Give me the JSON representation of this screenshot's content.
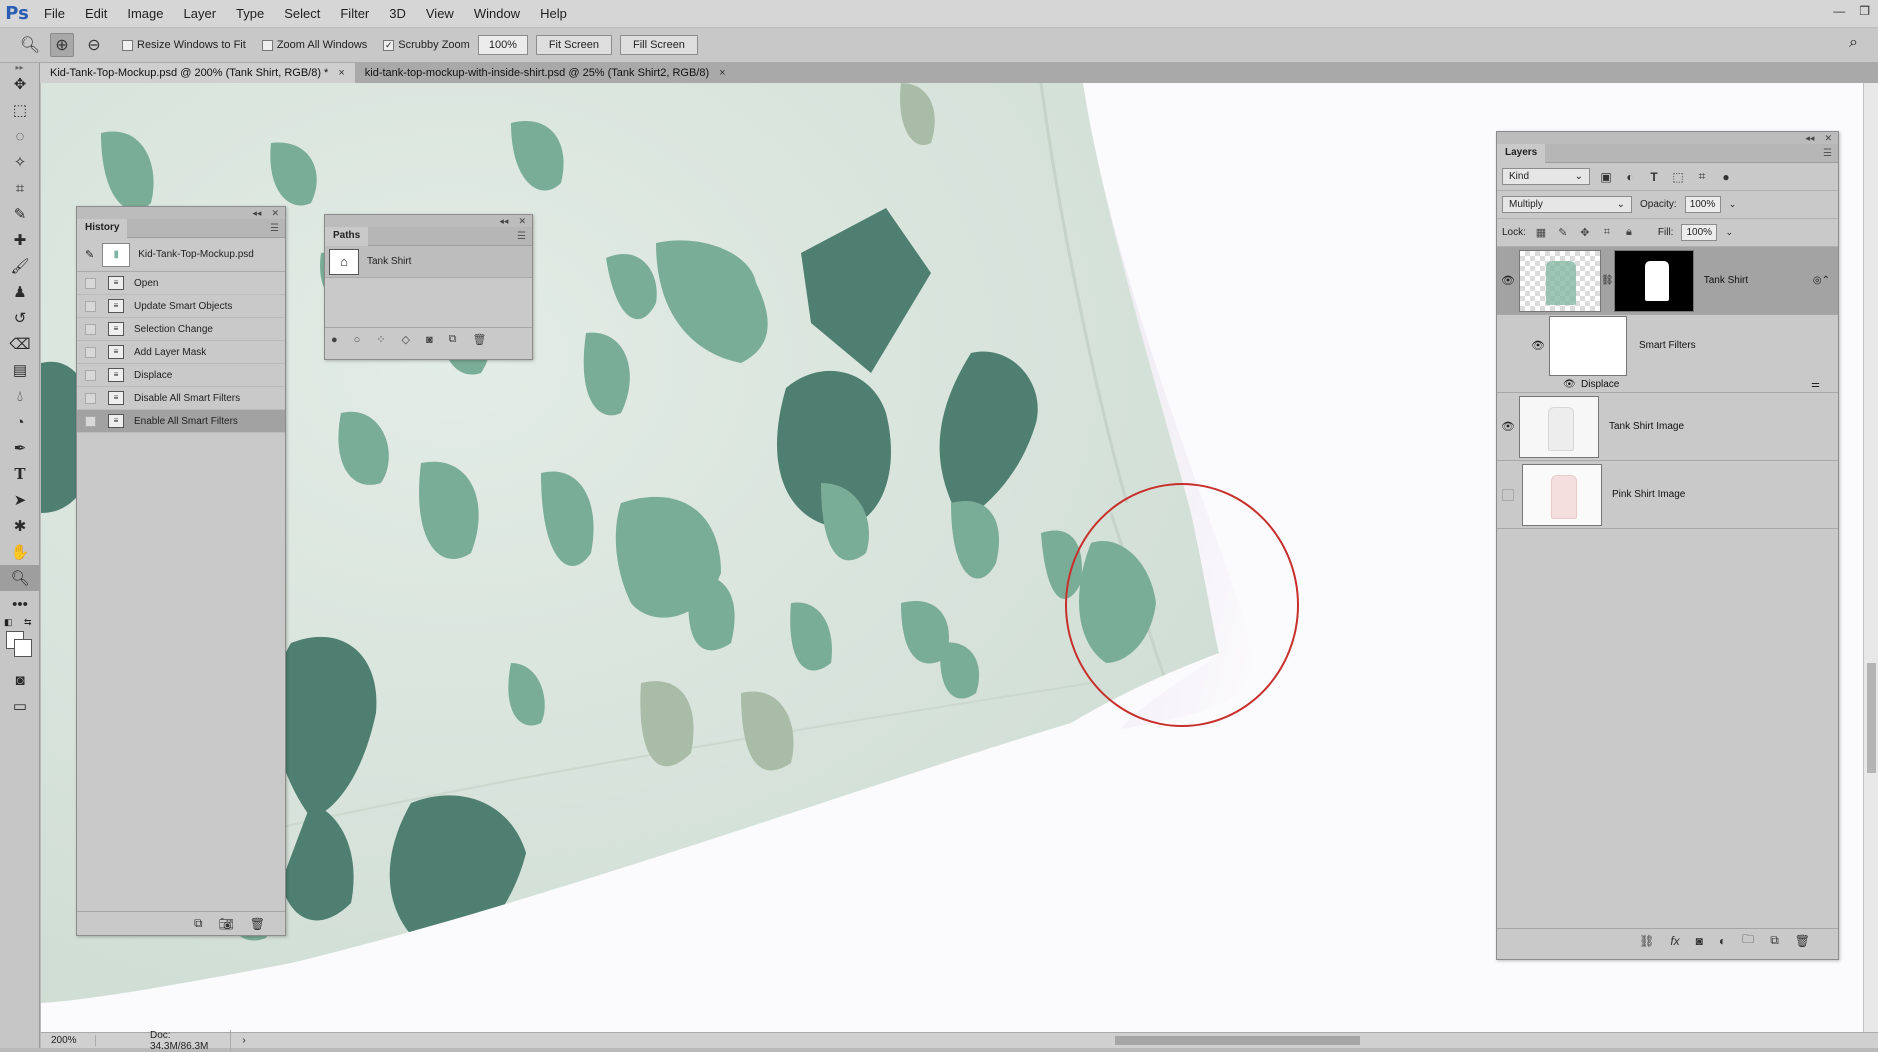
{
  "app": {
    "logo": "Ps"
  },
  "menu": [
    "File",
    "Edit",
    "Image",
    "Layer",
    "Type",
    "Select",
    "Filter",
    "3D",
    "View",
    "Window",
    "Help"
  ],
  "window_controls": {
    "minimize": "—",
    "restore": "❐"
  },
  "options": {
    "resize_windows": "Resize Windows to Fit",
    "zoom_all": "Zoom All Windows",
    "scrubby_zoom": "Scrubby Zoom",
    "zoom_value": "100%",
    "fit_screen": "Fit Screen",
    "fill_screen": "Fill Screen",
    "scrubby_checked": "✓"
  },
  "tabs": [
    {
      "label": "Kid-Tank-Top-Mockup.psd @ 200% (Tank Shirt, RGB/8) *",
      "close": "×"
    },
    {
      "label": "kid-tank-top-mockup-with-inside-shirt.psd @ 25% (Tank Shirt2, RGB/8)",
      "close": "×"
    }
  ],
  "history": {
    "tab": "History",
    "snapshot": "Kid-Tank-Top-Mockup.psd",
    "steps": [
      "Open",
      "Update Smart Objects",
      "Selection Change",
      "Add Layer Mask",
      "Displace",
      "Disable All Smart Filters",
      "Enable All Smart Filters"
    ],
    "selected_index": 6
  },
  "paths": {
    "tab": "Paths",
    "items": [
      "Tank Shirt"
    ]
  },
  "layers": {
    "tab": "Layers",
    "filter_kind": "Kind",
    "blend_mode": "Multiply",
    "opacity_label": "Opacity:",
    "opacity": "100%",
    "lock_label": "Lock:",
    "fill_label": "Fill:",
    "fill": "100%",
    "items": [
      {
        "name": "Tank Shirt",
        "visible": true,
        "selected": true
      },
      {
        "name": "Smart Filters",
        "visible": true
      },
      {
        "name": "Displace",
        "visible": true
      },
      {
        "name": "Tank Shirt Image",
        "visible": true
      },
      {
        "name": "Pink Shirt Image",
        "visible": false
      }
    ],
    "fx_label": "fx"
  },
  "status": {
    "zoom": "200%",
    "doc": "Doc: 34.3M/86.3M",
    "arrow": "›"
  },
  "colors": {
    "accent": "#2a5db3",
    "fabric": "#dbe7df",
    "pattern_dark": "#4f7f71",
    "pattern_mid": "#7aad97",
    "pattern_light": "#a9bca7",
    "highlight": "#c7302c"
  }
}
